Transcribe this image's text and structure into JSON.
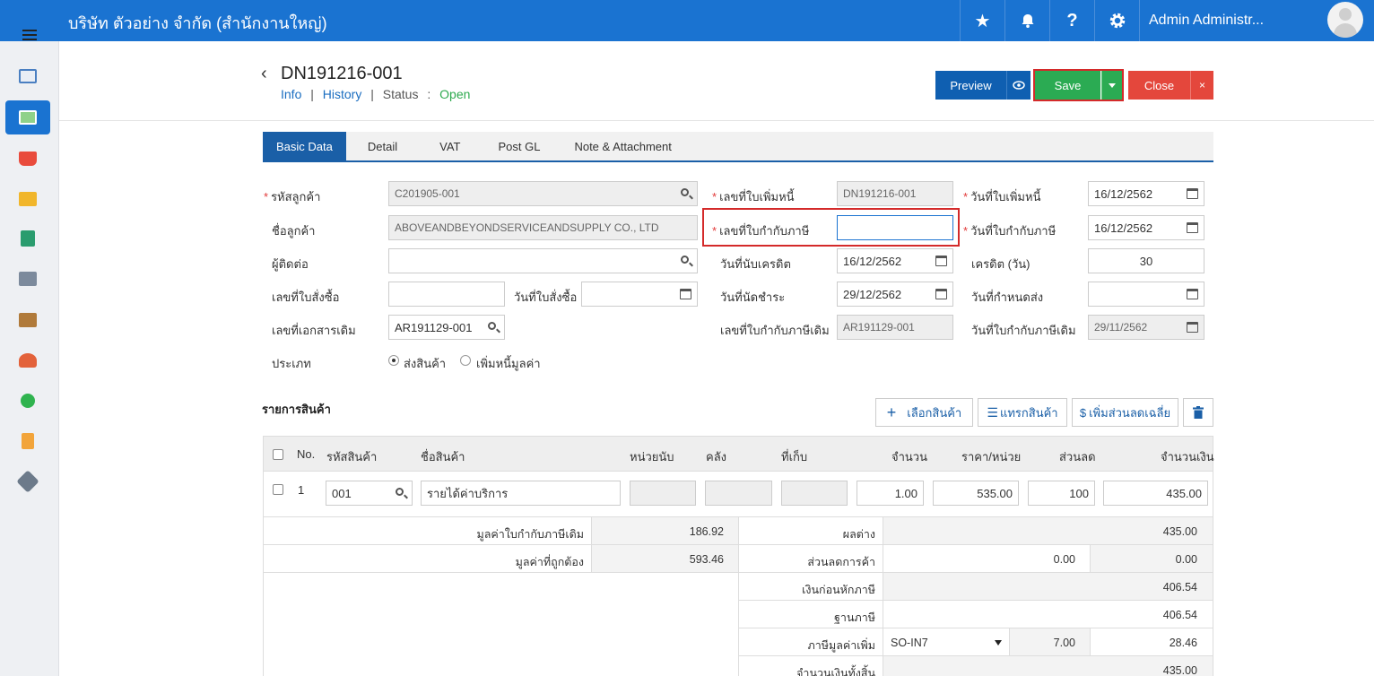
{
  "app": {
    "company": "บริษัท ตัวอย่าง จำกัด (สำนักงานใหญ่)",
    "user": "Admin Administr..."
  },
  "doc": {
    "number": "DN191216-001",
    "link_info": "Info",
    "link_history": "History",
    "status_label": "Status",
    "status_value": "Open",
    "sep": "|",
    "colon": ":"
  },
  "actions": {
    "preview": "Preview",
    "save": "Save",
    "close": "Close",
    "close_x": "×"
  },
  "tabs": [
    "Basic Data",
    "Detail",
    "VAT",
    "Post GL",
    "Note & Attachment"
  ],
  "form": {
    "customer_code_label": "รหัสลูกค้า",
    "customer_code": "C201905-001",
    "customer_name_label": "ชื่อลูกค้า",
    "customer_name": "ABOVEANDBEYONDSERVICEANDSUPPLY CO., LTD",
    "contact_label": "ผู้ติดต่อ",
    "contact": "",
    "po_no_label": "เลขที่ใบสั่งซื้อ",
    "po_no": "",
    "po_date_label": "วันที่ใบสั่งซื้อ",
    "po_date": "",
    "ref_doc_label": "เลขที่เอกสารเดิม",
    "ref_doc": "AR191129-001",
    "type_label": "ประเภท",
    "type_option1": "ส่งสินค้า",
    "type_option2": "เพิ่มหนี้มูลค่า",
    "dn_no_label": "เลขที่ใบเพิ่มหนี้",
    "dn_no": "DN191216-001",
    "tax_inv_label": "เลขที่ใบกำกับภาษี",
    "tax_inv": "",
    "credit_start_label": "วันที่นับเครดิต",
    "credit_start": "16/12/2562",
    "due_date_label": "วันที่นัดชำระ",
    "due_date": "29/12/2562",
    "orig_tax_inv_label": "เลขที่ใบกำกับภาษีเดิม",
    "orig_tax_inv": "AR191129-001",
    "dn_date_label": "วันที่ใบเพิ่มหนี้",
    "dn_date": "16/12/2562",
    "tax_date_label": "วันที่ใบกำกับภาษี",
    "tax_date": "16/12/2562",
    "credit_days_label": "เครดิต (วัน)",
    "credit_days": "30",
    "delivery_label": "วันที่กำหนดส่ง",
    "delivery": "",
    "orig_tax_date_label": "วันที่ใบกำกับภาษีเดิม",
    "orig_tax_date": "29/11/2562"
  },
  "products": {
    "title": "รายการสินค้า",
    "btn_select": "เลือกสินค้า",
    "btn_insert": "แทรกสินค้า",
    "btn_discount": "เพิ่มส่วนลดเฉลี่ย",
    "columns": {
      "no": "No.",
      "code": "รหัสสินค้า",
      "name": "ชื่อสินค้า",
      "unit": "หน่วยนับ",
      "warehouse": "คลัง",
      "location": "ที่เก็บ",
      "qty": "จำนวน",
      "price": "ราคา/หน่วย",
      "discount": "ส่วนลด",
      "amount": "จำนวนเงิน"
    },
    "rows": [
      {
        "no": "1",
        "code": "001",
        "name": "รายได้ค่าบริการ",
        "qty": "1.00",
        "price": "535.00",
        "discount": "100",
        "amount": "435.00"
      }
    ]
  },
  "summary": {
    "orig_value_label": "มูลค่าใบกำกับภาษีเดิม",
    "orig_value": "186.92",
    "correct_value_label": "มูลค่าที่ถูกต้อง",
    "correct_value": "593.46",
    "diff_label": "ผลต่าง",
    "diff": "435.00",
    "trade_disc_label": "ส่วนลดการค้า",
    "trade_disc_input": "0.00",
    "trade_disc": "0.00",
    "before_tax_label": "เงินก่อนหักภาษี",
    "before_tax": "406.54",
    "tax_base_label": "ฐานภาษี",
    "tax_base": "406.54",
    "vat_label": "ภาษีมูลค่าเพิ่ม",
    "vat_code": "SO-IN7",
    "vat_rate": "7.00",
    "vat_amount": "28.46",
    "total_label": "จำนวนเงินทั้งสิ้น",
    "total": "435.00"
  },
  "colors": {
    "topbar": "#1a73d1",
    "save": "#2bab53",
    "close": "#e4473c",
    "preview": "#0f5fb1",
    "highlight": "#d42a2a"
  }
}
